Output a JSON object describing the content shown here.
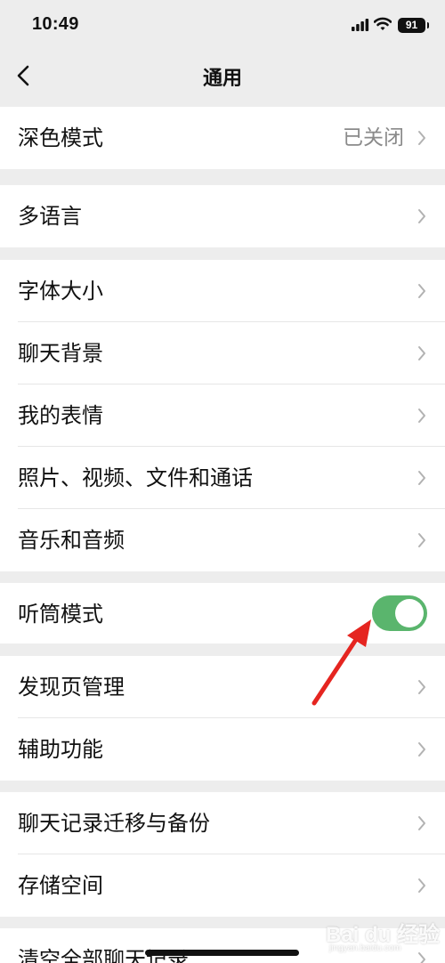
{
  "status_bar": {
    "time": "10:49",
    "battery": "91",
    "icons": [
      "signal-icon",
      "wifi-icon",
      "battery-icon"
    ]
  },
  "nav": {
    "title": "通用",
    "back_icon": "back-chevron-icon"
  },
  "groups": [
    {
      "rows": [
        {
          "label": "深色模式",
          "value": "已关闭"
        }
      ]
    },
    {
      "rows": [
        {
          "label": "多语言"
        }
      ]
    },
    {
      "rows": [
        {
          "label": "字体大小"
        },
        {
          "label": "聊天背景"
        },
        {
          "label": "我的表情"
        },
        {
          "label": "照片、视频、文件和通话"
        },
        {
          "label": "音乐和音频"
        }
      ]
    },
    {
      "rows": [
        {
          "label": "听筒模式",
          "toggle": true
        }
      ]
    },
    {
      "rows": [
        {
          "label": "发现页管理"
        },
        {
          "label": "辅助功能"
        }
      ]
    },
    {
      "rows": [
        {
          "label": "聊天记录迁移与备份"
        },
        {
          "label": "存储空间"
        }
      ]
    },
    {
      "rows": [
        {
          "label": "清空全部聊天记录"
        }
      ]
    }
  ],
  "watermark": {
    "main": "Bai du 经验",
    "sub": "jingyan.baidu.com"
  },
  "colors": {
    "background": "#ededed",
    "toggle_on": "#5ab56d",
    "annotation_arrow": "#e52520"
  }
}
